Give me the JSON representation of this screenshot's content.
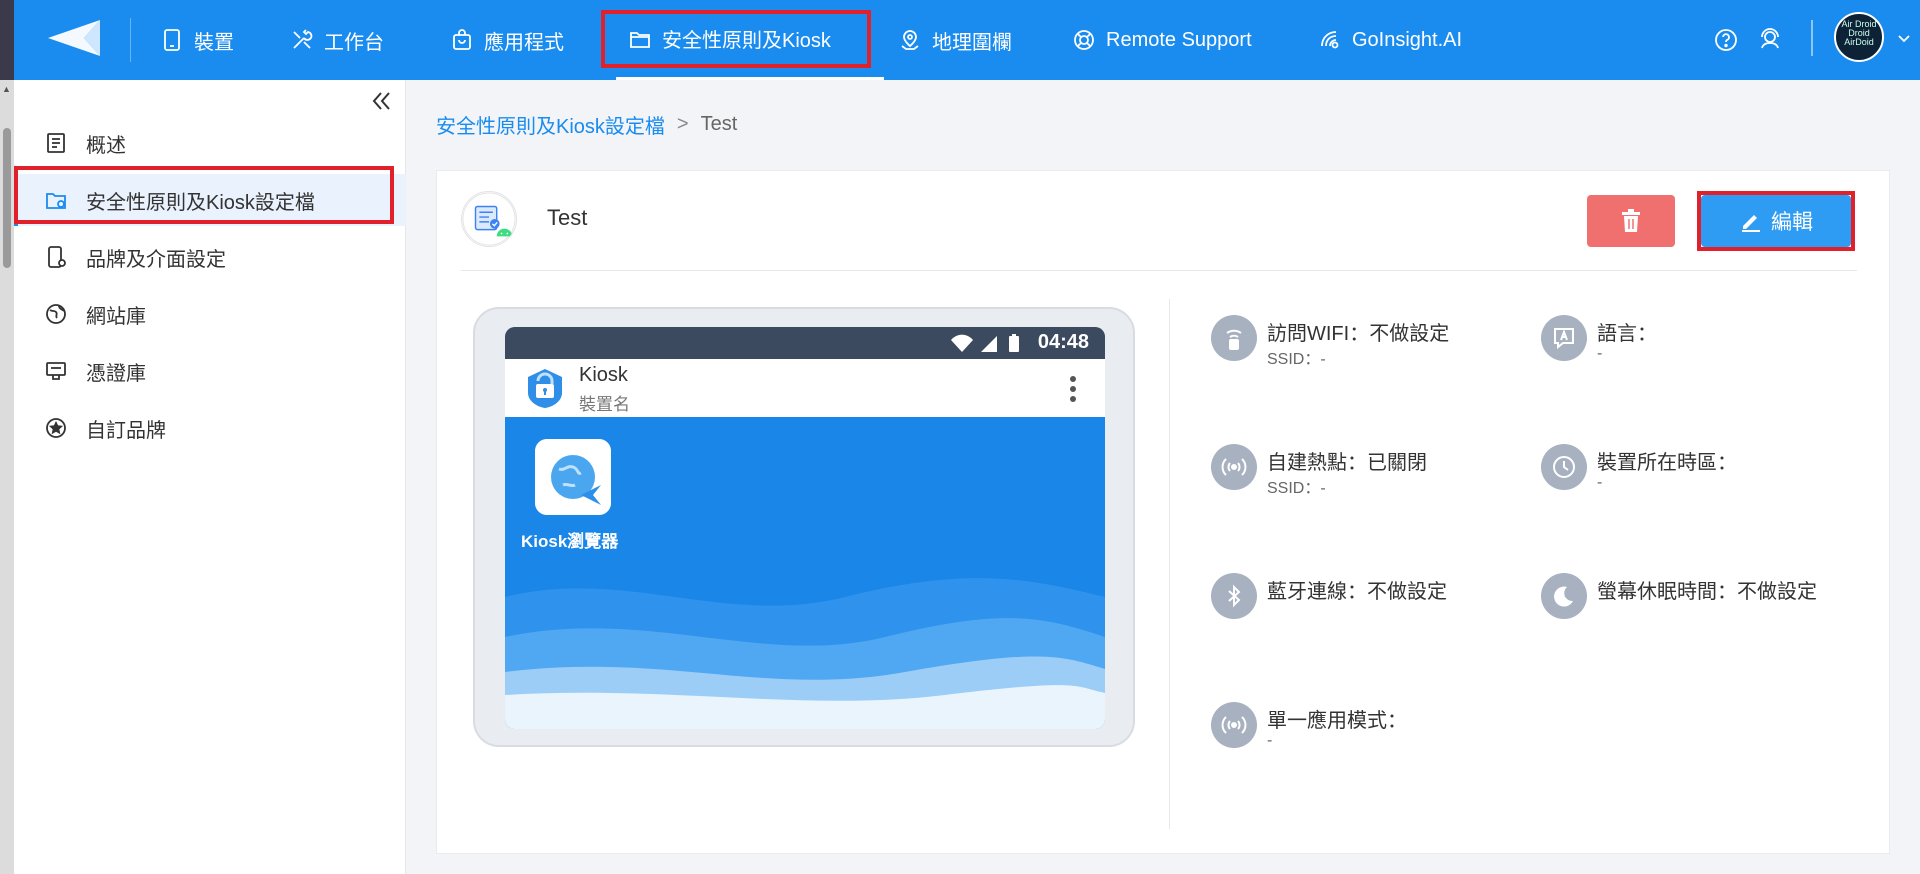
{
  "nav": {
    "items": [
      {
        "label": "裝置",
        "icon": "tablet-icon"
      },
      {
        "label": "工作台",
        "icon": "tools-icon"
      },
      {
        "label": "應用程式",
        "icon": "shopping-bag-icon"
      },
      {
        "label": "安全性原則及Kiosk",
        "icon": "folder-icon"
      },
      {
        "label": "地理圍欄",
        "icon": "map-pin-icon"
      },
      {
        "label": "Remote Support",
        "icon": "lifebuoy-icon"
      },
      {
        "label": "GoInsight.AI",
        "icon": "insight-icon"
      }
    ],
    "avatar_text": "Air Droid Droid AirDoid"
  },
  "sidebar": {
    "items": [
      {
        "label": "概述",
        "icon": "overview-icon"
      },
      {
        "label": "安全性原則及Kiosk設定檔",
        "icon": "folder-settings-icon"
      },
      {
        "label": "品牌及介面設定",
        "icon": "device-settings-icon"
      },
      {
        "label": "網站庫",
        "icon": "globe-icon"
      },
      {
        "label": "憑證庫",
        "icon": "certificate-icon"
      },
      {
        "label": "自訂品牌",
        "icon": "star-icon"
      }
    ]
  },
  "breadcrumb": {
    "parent": "安全性原則及Kiosk設定檔",
    "separator": ">",
    "current": "Test"
  },
  "profile": {
    "name": "Test",
    "edit_label": "編輯"
  },
  "preview": {
    "time": "04:48",
    "app_title": "Kiosk",
    "app_subtitle": "裝置名",
    "app_label": "Kiosk瀏覽器"
  },
  "settings": [
    {
      "label": "訪問WIFI：不做設定",
      "sub": "SSID：-",
      "icon": "wifi-icon"
    },
    {
      "label": "語言：",
      "sub": "-",
      "icon": "language-icon"
    },
    {
      "label": "自建熱點：已關閉",
      "sub": "SSID：-",
      "icon": "hotspot-icon"
    },
    {
      "label": "裝置所在時區：",
      "sub": "-",
      "icon": "clock-icon"
    },
    {
      "label": "藍牙連線：不做設定",
      "sub": "",
      "icon": "bluetooth-icon"
    },
    {
      "label": "螢幕休眠時間：不做設定",
      "sub": "",
      "icon": "sleep-icon"
    },
    {
      "label": "單一應用模式：",
      "sub": "-",
      "icon": "single-app-icon"
    }
  ],
  "colors": {
    "primary": "#1a8cf0",
    "danger": "#f07070",
    "highlight": "#e0202a"
  }
}
